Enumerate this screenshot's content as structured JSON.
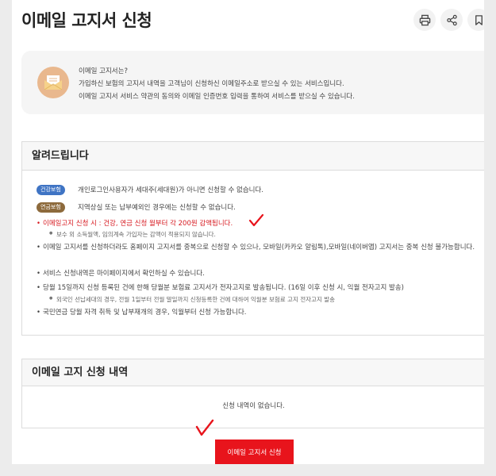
{
  "page_title": "이메일 고지서 신청",
  "toolbar": {
    "print_icon": "print-icon",
    "share_icon": "share-icon",
    "bookmark_icon": "bookmark-icon"
  },
  "intro": {
    "icon": "envelope-icon",
    "question": "이메일 고지서는?",
    "line1": "가입하신 보험의 고지서 내역을 고객님이 신청하신 이메일주소로 받으실 수 있는 서비스입니다.",
    "line2": "이메일 고지서 서비스 약관의 동의와 이메일 인증번호 입력을 통하여 서비스를 받으실 수 있습니다."
  },
  "notice": {
    "heading": "알려드립니다",
    "badge1": "건강보험",
    "badge1_text": "개인로그인사용자가 세대주(세대원)가 아니면 신청할 수 없습니다.",
    "badge2": "연금보험",
    "badge2_text": "지역상실 또는 납부예외인 경우에는 신청할 수 없습니다.",
    "item1": "이메일고지 신청 시 : 건강, 연금 신청 월부터 각 200원 감액됩니다.",
    "item1_sub": "보수 외 소득월액, 임의계속 가입자는 감액이 적용되지 않습니다.",
    "item2": "이메일 고지서를 신청하더라도 홈페이지 고지서를 중복으로 신청할 수 있으나, 모바일(카카오 알림톡),모바일(네이버앱) 고지서는 중복 신청 불가능합니다.",
    "item3": "서비스 신청내역은 마이페이지에서 확인하실 수 있습니다.",
    "item4": "당월 15일까지 신청 등록된 건에 한해 당월분 보험료 고지서가 전자고지로 발송됩니다. (16일 이후 신청 시, 익월 전자고지 발송)",
    "item4_sub": "외국인 선납세대의 경우, 전월 1일부터 전월 말일까지 신청등록한 건에 대하여 익월분 보험료 고지 전자고지 발송",
    "item5": "국민연금 당월 자격 취득 및 납부재개의 경우, 익월부터 신청 가능합니다."
  },
  "history": {
    "heading": "이메일 고지 신청 내역",
    "empty": "신청 내역이 없습니다."
  },
  "apply_button": "이메일 고지서 신청",
  "colors": {
    "accent_red": "#e8141c",
    "badge_blue": "#3f74c4",
    "badge_brown": "#8d6a3c"
  }
}
